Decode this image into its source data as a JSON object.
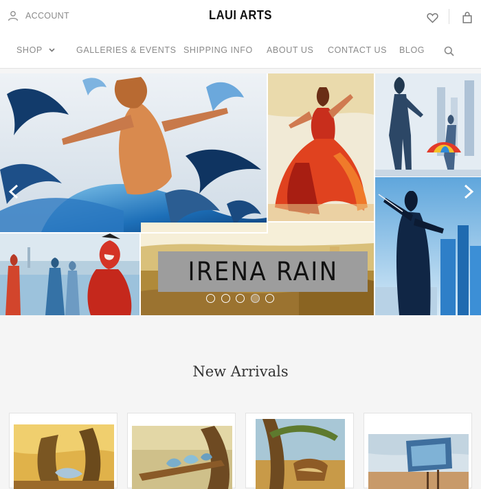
{
  "header": {
    "account_label": "ACCOUNT",
    "logo_text": "LAUI ARTS",
    "icons": {
      "account": "user-icon",
      "wishlist": "heart-icon",
      "cart": "shopping-bag-icon",
      "search": "search-icon"
    }
  },
  "nav": {
    "items": [
      {
        "label": "SHOP",
        "has_dropdown": true
      },
      {
        "label": "GALLERIES & EVENTS"
      },
      {
        "label": "SHIPPING INFO"
      },
      {
        "label": "ABOUT US"
      },
      {
        "label": "CONTACT US"
      },
      {
        "label": "BLOG"
      }
    ]
  },
  "hero": {
    "banner_text": "IRENA RAIN",
    "slide_count": 5,
    "active_slide": 4,
    "icons": {
      "prev": "chevron-left-icon",
      "next": "chevron-right-icon"
    }
  },
  "new_arrivals": {
    "title": "New Arrivals",
    "product_count": 4
  },
  "colors": {
    "nav_text": "#8a8a8a",
    "logo": "#111111",
    "page_bg": "#f5f5f5",
    "banner_bg": "#9d9d9d"
  }
}
